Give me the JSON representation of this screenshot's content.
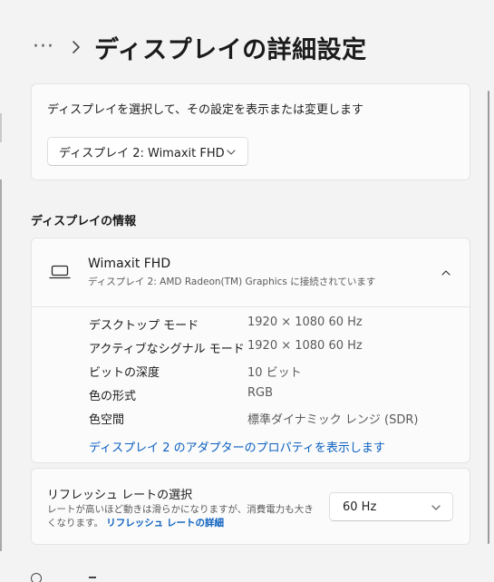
{
  "header": {
    "more_label": "···",
    "title": "ディスプレイの詳細設定"
  },
  "select_display": {
    "description": "ディスプレイを選択して、その設定を表示または変更します",
    "selected": "ディスプレイ 2: Wimaxit FHD"
  },
  "info_section": {
    "heading": "ディスプレイの情報",
    "monitor_name": "Wimaxit FHD",
    "connection": "ディスプレイ 2: AMD Radeon(TM) Graphics に接続されています",
    "rows": [
      {
        "key": "デスクトップ モード",
        "value": "1920 × 1080 60 Hz"
      },
      {
        "key": "アクティブなシグナル モード",
        "value": "1920 × 1080 60 Hz"
      },
      {
        "key": "ビットの深度",
        "value": "10 ビット"
      },
      {
        "key": "色の形式",
        "value": "RGB"
      },
      {
        "key": "色空間",
        "value": "標準ダイナミック レンジ (SDR)"
      }
    ],
    "adapter_link": "ディスプレイ 2 のアダプターのプロパティを表示します"
  },
  "refresh": {
    "title": "リフレッシュ レートの選択",
    "description": "レートが高いほど動きは滑らかになりますが、消費電力も大きくなります。",
    "link": "リフレッシュ レートの詳細",
    "selected": "60 Hz"
  },
  "colors": {
    "accent_link": "#0a5fbf",
    "background": "#f3f3f3",
    "card": "#fbfbfb"
  },
  "icons": {
    "breadcrumb_chevron": "chevron-right-icon",
    "dropdown_chevron": "chevron-down-icon",
    "collapse_chevron": "chevron-up-icon",
    "monitor": "laptop-icon"
  }
}
